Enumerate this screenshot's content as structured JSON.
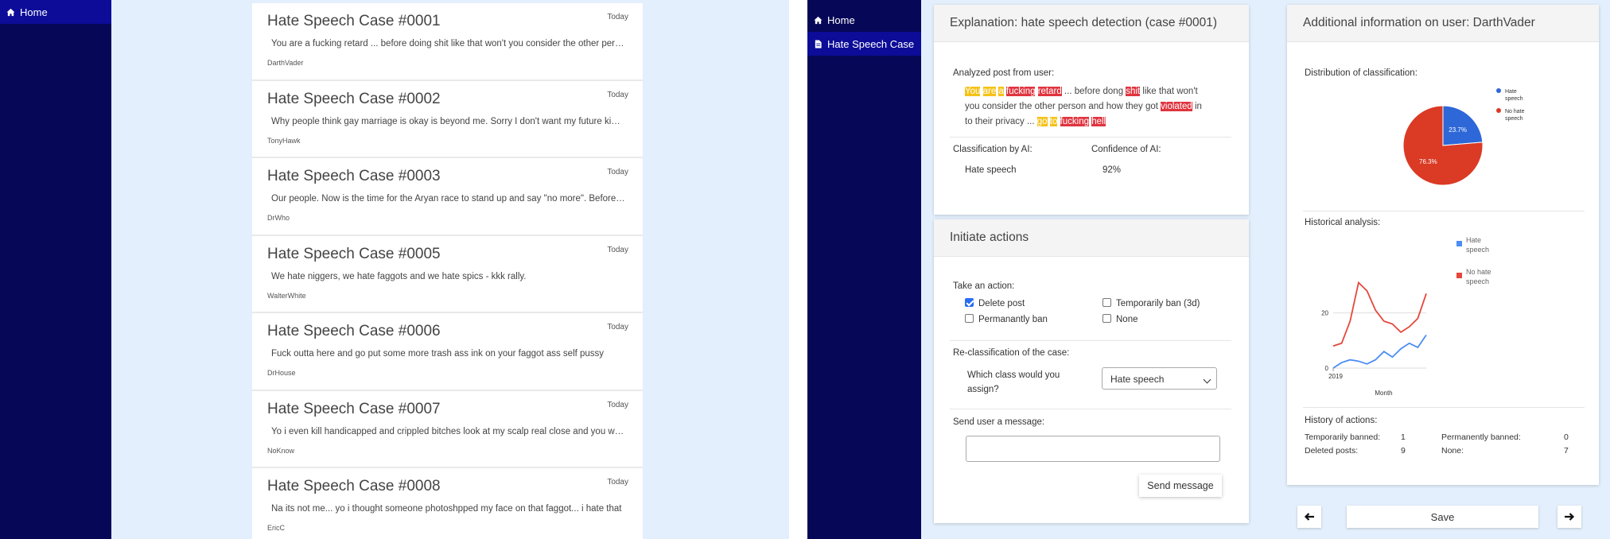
{
  "left": {
    "sidebar": {
      "home_label": "Home"
    },
    "cases": [
      {
        "title": "Hate Speech Case #0001",
        "date": "Today",
        "snippet": "You are a fucking retard ... before doing shit like that won't you consider the other person and how they got violated in to their privacy",
        "user": "DarthVader"
      },
      {
        "title": "Hate Speech Case #0002",
        "date": "Today",
        "snippet": "Why people think gay marriage is okay is beyond me. Sorry I don't want my future kids to grow up in this",
        "user": "TonyHawk"
      },
      {
        "title": "Hate Speech Case #0003",
        "date": "Today",
        "snippet": "Our people. Now is the time for the Aryan race to stand up and say \"no more\". Before it is too late",
        "user": "DrWho"
      },
      {
        "title": "Hate Speech Case #0005",
        "date": "Today",
        "snippet": "We hate niggers, we hate faggots and we hate spics - kkk rally.",
        "user": "WalterWhite"
      },
      {
        "title": "Hate Speech Case #0006",
        "date": "Today",
        "snippet": "Fuck outta here and go put some more trash ass ink on your faggot ass self pussy",
        "user": "DrHouse"
      },
      {
        "title": "Hate Speech Case #0007",
        "date": "Today",
        "snippet": "Yo i even kill handicapped and crippled bitches look at my scalp real close and you will see",
        "user": "NoKnow"
      },
      {
        "title": "Hate Speech Case #0008",
        "date": "Today",
        "snippet": "Na its not me... yo i thought someone photoshpped my face on that faggot... i hate that",
        "user": "EricC"
      }
    ]
  },
  "right": {
    "sidebar": {
      "home_label": "Home",
      "case_label": "Hate Speech Case"
    },
    "explanation": {
      "header": "Explanation: hate speech detection (case #0001)",
      "analyzed_label": "Analyzed post from user:",
      "post_line1": [
        {
          "t": "You",
          "h": "y"
        },
        {
          "t": " ",
          "h": ""
        },
        {
          "t": "are",
          "h": "y"
        },
        {
          "t": " ",
          "h": ""
        },
        {
          "t": "a",
          "h": "y"
        },
        {
          "t": " ",
          "h": ""
        },
        {
          "t": "fucking",
          "h": "r"
        },
        {
          "t": " ",
          "h": ""
        },
        {
          "t": "retard",
          "h": "r"
        },
        {
          "t": " ... before dong ",
          "h": ""
        },
        {
          "t": "shit",
          "h": "r"
        },
        {
          "t": " like that won't",
          "h": ""
        }
      ],
      "post_line2": [
        {
          "t": "you consider the other person and how they got ",
          "h": ""
        },
        {
          "t": "violated",
          "h": "r"
        },
        {
          "t": " in",
          "h": ""
        }
      ],
      "post_line3": [
        {
          "t": "to their privacy ... ",
          "h": ""
        },
        {
          "t": "go",
          "h": "y"
        },
        {
          "t": " ",
          "h": ""
        },
        {
          "t": "to",
          "h": "y"
        },
        {
          "t": " ",
          "h": ""
        },
        {
          "t": "fucking",
          "h": "r"
        },
        {
          "t": " ",
          "h": ""
        },
        {
          "t": "hell",
          "h": "r"
        }
      ],
      "class_label": "Classification by AI:",
      "class_value": "Hate speech",
      "conf_label": "Confidence of AI:",
      "conf_value": "92%"
    },
    "actions": {
      "header": "Initiate actions",
      "take_label": "Take an action:",
      "options": [
        {
          "label": "Delete post",
          "checked": true
        },
        {
          "label": "Temporarily ban (3d)",
          "checked": false
        },
        {
          "label": "Permanantly ban",
          "checked": false
        },
        {
          "label": "None",
          "checked": false
        }
      ],
      "reclass_label": "Re-classification of the case:",
      "which_line1": "Which class would you",
      "which_line2": "assign?",
      "select_value": "Hate speech",
      "message_label": "Send user a message:",
      "message_value": "",
      "send_label": "Send message"
    },
    "info": {
      "header": "Additional information on user: DarthVader",
      "dist_label": "Distribution of classification:",
      "hist_label": "Historical analysis:",
      "history_label": "History of actions:",
      "history": {
        "temp_label": "Temporarily banned:",
        "temp_value": "1",
        "perm_label": "Permanently banned:",
        "perm_value": "0",
        "del_label": "Deleted posts:",
        "del_value": "9",
        "none_label": "None:",
        "none_value": "7"
      }
    },
    "footer": {
      "save_label": "Save",
      "prev_icon": "arrow-left-icon",
      "next_icon": "arrow-right-icon"
    },
    "colors": {
      "hate": "#2e67d8",
      "no_hate": "#db3a25",
      "line_hate": "#4c8df5",
      "line_no_hate": "#e5473a"
    }
  },
  "chart_data": [
    {
      "type": "pie",
      "labels": [
        "Hate speech",
        "No hate speech"
      ],
      "legend_lines": [
        [
          "Hate",
          "speech"
        ],
        [
          "No hate",
          "speech"
        ]
      ],
      "values": [
        23.7,
        76.3
      ],
      "value_labels": [
        "23.7%",
        "76.3%"
      ],
      "legend": "right"
    },
    {
      "type": "line",
      "xlabel": "Month",
      "x_tick_labels": [
        "2019"
      ],
      "y_ticks": [
        0,
        20
      ],
      "ylim": [
        0,
        32
      ],
      "series": [
        {
          "name": "Hate speech",
          "legend_lines": [
            "Hate",
            "speech"
          ],
          "values": [
            0,
            2,
            3,
            2.5,
            1.5,
            3,
            6,
            4,
            7,
            9,
            7.5,
            12
          ]
        },
        {
          "name": "No hate speech",
          "legend_lines": [
            "No hate",
            "speech"
          ],
          "values": [
            8,
            9,
            17,
            31,
            28,
            21,
            17,
            16,
            13,
            15,
            18,
            27
          ]
        }
      ],
      "legend": "right"
    }
  ]
}
